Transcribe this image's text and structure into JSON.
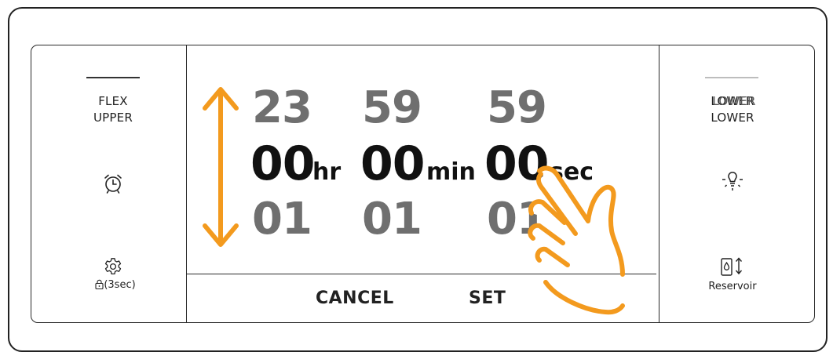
{
  "left_panel": {
    "zone_line1": "FLEX",
    "zone_line2": "UPPER",
    "lock_label": "(3sec)",
    "icons": [
      "alarm-clock-icon",
      "gear-icon",
      "lock-icon"
    ]
  },
  "right_panel": {
    "zone_line1": "LOWER",
    "zone_line2": "LOWER",
    "reservoir_label": "Reservoir",
    "icons": [
      "light-bulb-icon",
      "reservoir-icon"
    ]
  },
  "timer": {
    "hours": {
      "prev": "23",
      "current": "00",
      "next": "01",
      "unit": "hr"
    },
    "minutes": {
      "prev": "59",
      "current": "00",
      "next": "01",
      "unit": "min"
    },
    "seconds": {
      "prev": "59",
      "current": "00",
      "next": "01",
      "unit": "sec"
    }
  },
  "actions": {
    "cancel_label": "CANCEL",
    "set_label": "SET"
  },
  "colors": {
    "accent": "#F39A1E",
    "frame": "#222222",
    "faded_digits": "#6F6F6F"
  },
  "gesture_icons": [
    "up-down-arrow-icon",
    "swipe-hand-icon"
  ]
}
